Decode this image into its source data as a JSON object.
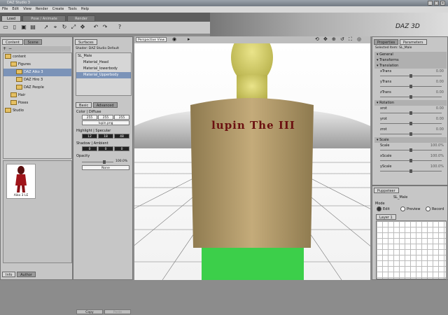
{
  "app": {
    "title": "DAZ Studio 3",
    "brand": "DAZ 3D",
    "window_controls": [
      "_",
      "□",
      "×"
    ]
  },
  "menu": [
    "File",
    "Edit",
    "View",
    "Render",
    "Create",
    "Tools",
    "Help"
  ],
  "top_tabs": [
    "Load",
    "Pose / Animate",
    "Render"
  ],
  "toolbar_icons": [
    "folder-open-icon",
    "new-file-icon",
    "save-icon",
    "open-icon",
    "pointer-icon",
    "node-select-icon",
    "rotate-icon",
    "scale-icon",
    "universal-icon",
    "undo-icon",
    "redo-icon",
    "help-icon"
  ],
  "content_panel": {
    "tabs": [
      "Content",
      "Scene"
    ],
    "tree": [
      {
        "label": "content",
        "level": 0
      },
      {
        "label": "Figures",
        "level": 1
      },
      {
        "label": "DAZ Aiko 3",
        "level": 2,
        "selected": true
      },
      {
        "label": "DAZ Hiro 3",
        "level": 2
      },
      {
        "label": "DAZ People",
        "level": 2
      },
      {
        "label": "Hair",
        "level": 1
      },
      {
        "label": "Poses",
        "level": 1
      },
      {
        "label": "Studio",
        "level": 0
      }
    ],
    "thumbnail_label": "Aiko 3 LE",
    "bottom_tabs": [
      "Info",
      "Author"
    ]
  },
  "surfaces_panel": {
    "title": "Surfaces",
    "shader": "Shader: DAZ Studio Default",
    "items": [
      "SL_Male",
      "Material_Head",
      "Material_lowerbody",
      "Material_Upperbody"
    ],
    "selected_index": 3,
    "tabs": [
      "Basic",
      "Advanced"
    ],
    "color_label": "Color | Diffuse",
    "color_values": [
      "255",
      "255",
      "255"
    ],
    "texture": "lupin.png",
    "highlight_label": "Highlight | Specular",
    "highlight_values": [
      "12",
      "18",
      "48"
    ],
    "shadow_label": "Shadow | Ambient",
    "shadow_values": [
      "0",
      "0",
      "0"
    ],
    "opacity_label": "Opacity",
    "opacity_value": "100.0%",
    "opacity_map": "None",
    "copy_button": "Copy",
    "paste_button": "Paste"
  },
  "viewport": {
    "view_name": "Perspective View",
    "shirt_text": "lupin The III"
  },
  "parameters_panel": {
    "tabs": [
      "Properties",
      "Parameters"
    ],
    "selected_item": "Selected Item: SL_Male",
    "groups": [
      {
        "type": "group",
        "label": "General"
      },
      {
        "type": "group",
        "label": "Transforms"
      },
      {
        "type": "group",
        "label": "Translation"
      },
      {
        "type": "param",
        "label": "xTrans",
        "value": "0.00",
        "pos": 0.5
      },
      {
        "type": "param",
        "label": "yTrans",
        "value": "0.00",
        "pos": 0.5
      },
      {
        "type": "param",
        "label": "zTrans",
        "value": "0.00",
        "pos": 0.5
      },
      {
        "type": "group",
        "label": "Rotation"
      },
      {
        "type": "param",
        "label": "xrot",
        "value": "0.00",
        "pos": 0.5
      },
      {
        "type": "param",
        "label": "yrot",
        "value": "0.00",
        "pos": 0.5
      },
      {
        "type": "param",
        "label": "zrot",
        "value": "0.00",
        "pos": 0.5
      },
      {
        "type": "group",
        "label": "Scale"
      },
      {
        "type": "param",
        "label": "Scale",
        "value": "100.0%",
        "pos": 0.5
      },
      {
        "type": "param",
        "label": "xScale",
        "value": "100.0%",
        "pos": 0.5
      },
      {
        "type": "param",
        "label": "yScale",
        "value": "100.0%",
        "pos": 0.5
      }
    ]
  },
  "puppeteer_panel": {
    "title": "Puppeteer",
    "figure": "SL_Male",
    "mode_label": "Mode",
    "modes": [
      "Edit",
      "Preview",
      "Record"
    ],
    "selected_mode": "Edit",
    "layer_tab": "Layer 1"
  },
  "colors": {
    "accent": "#7b93b8",
    "panel": "#c6c6c6",
    "skin": "#d9d46a",
    "shirt": "#b89d6b",
    "pants": "#3ccf4a"
  }
}
